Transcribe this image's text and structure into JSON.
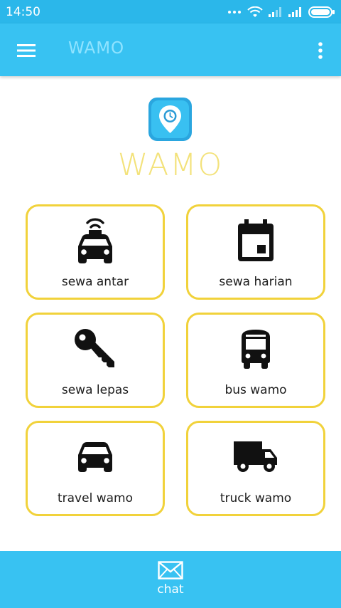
{
  "status_bar": {
    "time": "14:50"
  },
  "app_bar": {
    "title": "WAMO"
  },
  "logo": {
    "title": "WAMO"
  },
  "tiles": [
    {
      "label": "sewa antar",
      "icon": "taxi-icon"
    },
    {
      "label": "sewa harian",
      "icon": "calendar-icon"
    },
    {
      "label": "sewa lepas",
      "icon": "key-icon"
    },
    {
      "label": "bus wamo",
      "icon": "bus-icon"
    },
    {
      "label": "travel wamo",
      "icon": "car-icon"
    },
    {
      "label": "truck wamo",
      "icon": "truck-icon"
    }
  ],
  "bottom_bar": {
    "label": "chat",
    "icon": "mail-icon"
  },
  "colors": {
    "status_bar": "#2bb7ea",
    "app_bar": "#38c2f2",
    "tile_border": "#f1d23b",
    "logo_title": "#f3e27a",
    "app_title": "#8fe3ff"
  }
}
